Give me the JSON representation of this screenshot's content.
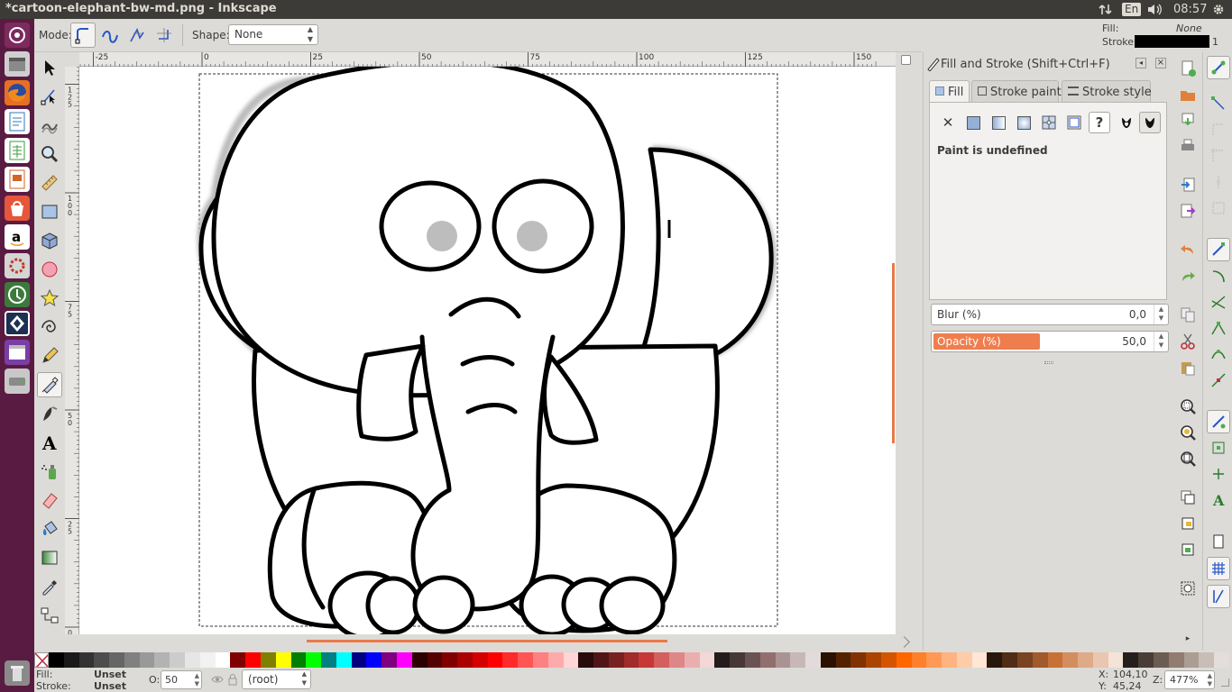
{
  "window": {
    "title": "*cartoon-elephant-bw-md.png - Inkscape"
  },
  "topbar": {
    "keyboard_layout": "En",
    "clock": "08:57"
  },
  "tool_controls": {
    "mode_label": "Mode:",
    "shape_label": "Shape:",
    "shape_value": "None"
  },
  "fill_stroke_indicator": {
    "fill_label": "Fill:",
    "fill_value": "None",
    "stroke_label": "Stroke:",
    "stroke_width": "1",
    "stroke_color": "#000000"
  },
  "ruler": {
    "h_ticks": [
      "-25",
      "0",
      "25",
      "50",
      "75",
      "100",
      "125",
      "150"
    ],
    "v_ticks": [
      "1 2 5",
      "1 0 0",
      "7 5",
      "5 0",
      "2 5",
      "0"
    ]
  },
  "dialog": {
    "title": "Fill and Stroke (Shift+Ctrl+F)",
    "tabs": [
      {
        "label": "Fill"
      },
      {
        "label": "Stroke paint"
      },
      {
        "label": "Stroke style"
      }
    ],
    "paint_status": "Paint is undefined",
    "blur_label": "Blur (%)",
    "blur_value": "0,0",
    "opacity_label": "Opacity (%)",
    "opacity_value": "50,0",
    "opacity_fraction": 0.5
  },
  "palette_colors": [
    "#000000",
    "#1a1a1a",
    "#333333",
    "#4d4d4d",
    "#666666",
    "#808080",
    "#999999",
    "#b3b3b3",
    "#cccccc",
    "#e6e6e6",
    "#f2f2f2",
    "#ffffff",
    "#800000",
    "#ff0000",
    "#808000",
    "#ffff00",
    "#008000",
    "#00ff00",
    "#008080",
    "#00ffff",
    "#000080",
    "#0000ff",
    "#800080",
    "#ff00ff",
    "#2b0000",
    "#550000",
    "#800000",
    "#aa0000",
    "#d40000",
    "#ff0000",
    "#ff2a2a",
    "#ff5555",
    "#ff8080",
    "#ffaaaa",
    "#ffd5d5",
    "#280b0b",
    "#501616",
    "#782121",
    "#a02c2c",
    "#c83737",
    "#d35f5f",
    "#de8787",
    "#e9afaf",
    "#f4d7d7",
    "#241c1c",
    "#483737",
    "#6c5353",
    "#916f6f",
    "#ac9393",
    "#c8b7b7",
    "#e3dbdb",
    "#2b1100",
    "#552200",
    "#803300",
    "#aa4400",
    "#d45500",
    "#ff6600",
    "#ff7f2a",
    "#ff9955",
    "#ffb380",
    "#ffccaa",
    "#ffe6d5",
    "#28170b",
    "#502d16",
    "#784421",
    "#a05a2c",
    "#c87137",
    "#d38d5f",
    "#deaa87",
    "#e9c6af",
    "#f4e3d7",
    "#241f1c",
    "#483e37",
    "#6c5d53",
    "#917c6f",
    "#ac9d93",
    "#c8beb7",
    "#e3dedb"
  ],
  "status": {
    "fill_label": "Fill:",
    "fill_value": "Unset",
    "stroke_label": "Stroke:",
    "stroke_value": "Unset",
    "opacity_label": "O:",
    "opacity_value": "50",
    "layer_value": "(root)",
    "x_label": "X:",
    "x_value": "104,10",
    "y_label": "Y:",
    "y_value": "45,24",
    "zoom_label": "Z:",
    "zoom_value": "477%"
  }
}
